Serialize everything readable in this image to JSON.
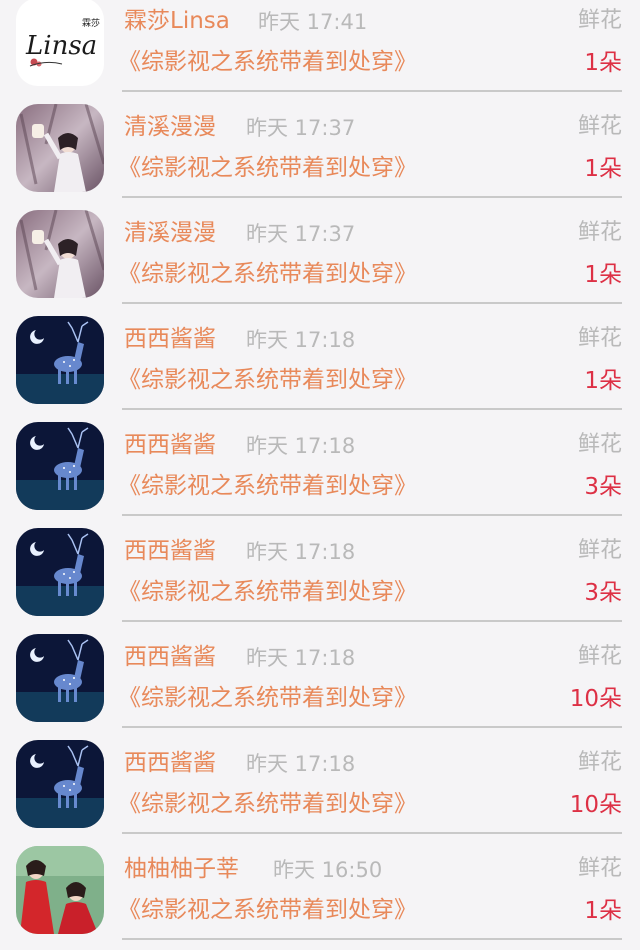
{
  "items": [
    {
      "user": "霖莎Linsa",
      "time": "昨天 17:41",
      "gift": "鲜花",
      "book": "《综影视之系统带着到处穿》",
      "count": "1朵",
      "avatar": "linsa-logo-avatar",
      "avatar_logo_text": "霖莎",
      "avatar_script_text": "Linsa"
    },
    {
      "user": "清溪漫漫",
      "time": "昨天 17:37",
      "gift": "鲜花",
      "book": "《综影视之系统带着到处穿》",
      "count": "1朵",
      "avatar": "girl-lantern-avatar"
    },
    {
      "user": "清溪漫漫",
      "time": "昨天 17:37",
      "gift": "鲜花",
      "book": "《综影视之系统带着到处穿》",
      "count": "1朵",
      "avatar": "girl-lantern-avatar"
    },
    {
      "user": "西西酱酱",
      "time": "昨天 17:18",
      "gift": "鲜花",
      "book": "《综影视之系统带着到处穿》",
      "count": "1朵",
      "avatar": "night-deer-avatar"
    },
    {
      "user": "西西酱酱",
      "time": "昨天 17:18",
      "gift": "鲜花",
      "book": "《综影视之系统带着到处穿》",
      "count": "3朵",
      "avatar": "night-deer-avatar"
    },
    {
      "user": "西西酱酱",
      "time": "昨天 17:18",
      "gift": "鲜花",
      "book": "《综影视之系统带着到处穿》",
      "count": "3朵",
      "avatar": "night-deer-avatar"
    },
    {
      "user": "西西酱酱",
      "time": "昨天 17:18",
      "gift": "鲜花",
      "book": "《综影视之系统带着到处穿》",
      "count": "10朵",
      "avatar": "night-deer-avatar"
    },
    {
      "user": "西西酱酱",
      "time": "昨天 17:18",
      "gift": "鲜花",
      "book": "《综影视之系统带着到处穿》",
      "count": "10朵",
      "avatar": "night-deer-avatar"
    },
    {
      "user": "柚柚柚子莘",
      "time": "昨天 16:50",
      "gift": "鲜花",
      "book": "《综影视之系统带着到处穿》",
      "count": "1朵",
      "avatar": "red-dress-girls-avatar"
    }
  ],
  "colors": {
    "name": "#e8895a",
    "book": "#e8895a",
    "meta": "#b9b9b9",
    "count": "#dd3045",
    "divider": "#c9c9c9",
    "background": "#f5f4f6"
  }
}
